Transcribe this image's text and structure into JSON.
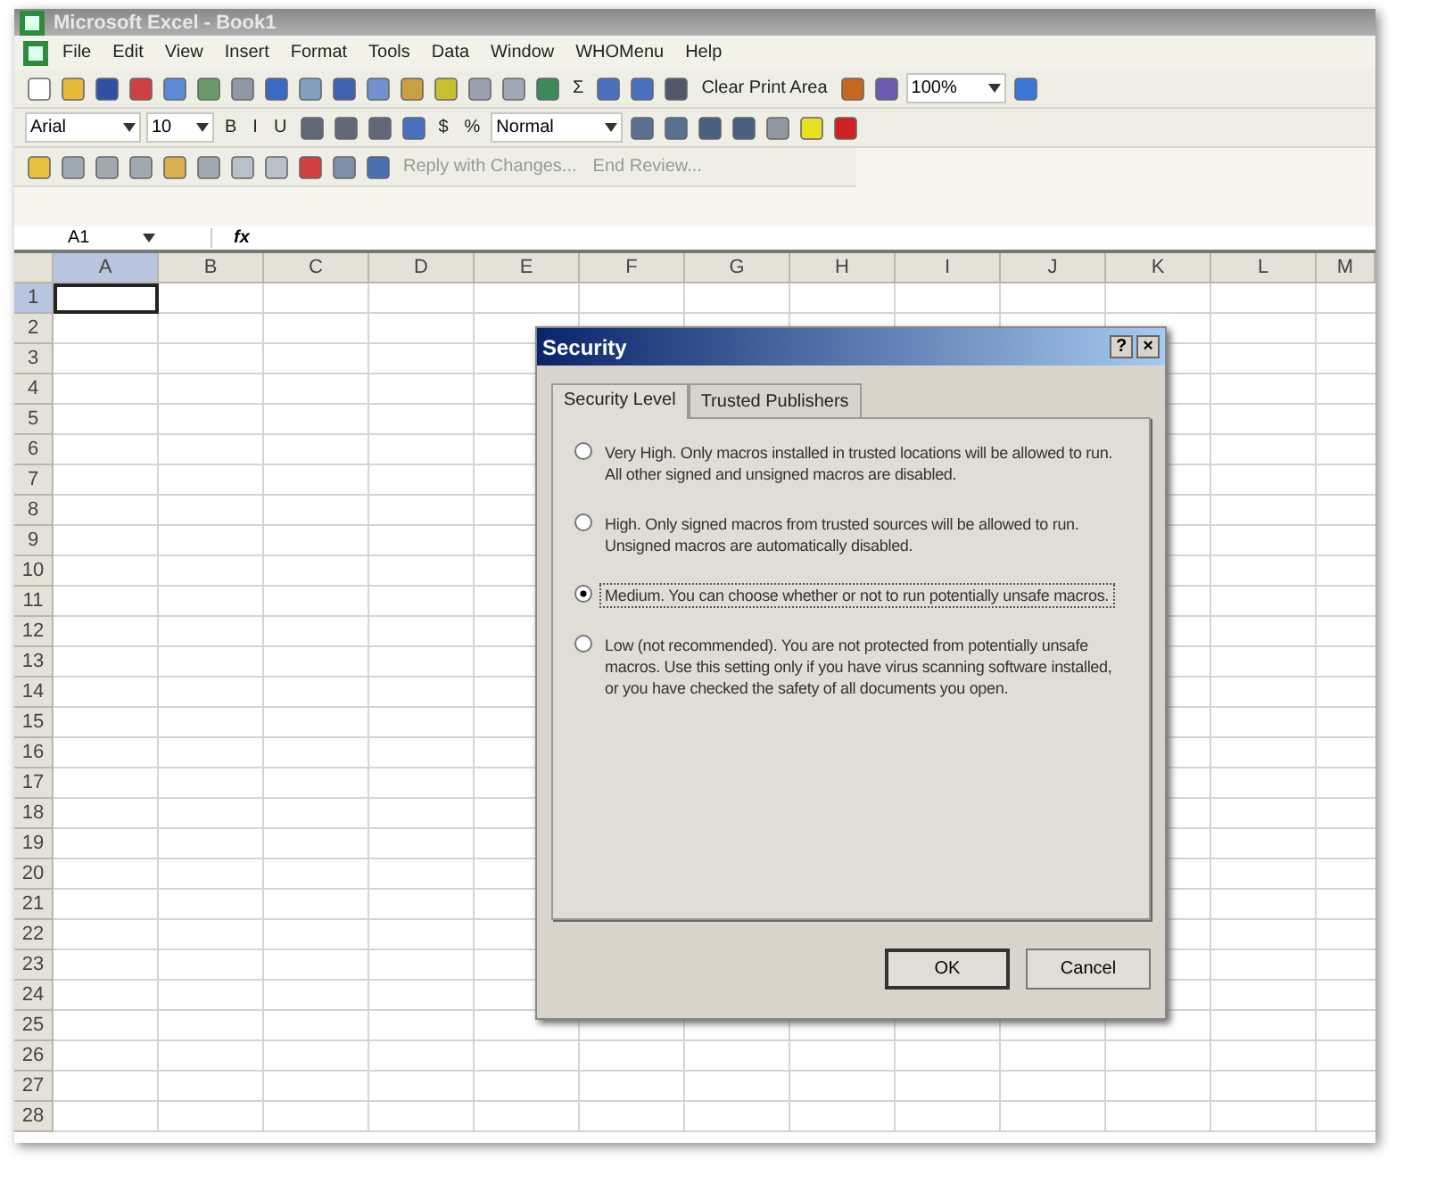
{
  "window": {
    "title": "Microsoft Excel - Book1"
  },
  "menu": [
    {
      "label": "File"
    },
    {
      "label": "Edit"
    },
    {
      "label": "View"
    },
    {
      "label": "Insert"
    },
    {
      "label": "Format"
    },
    {
      "label": "Tools"
    },
    {
      "label": "Data"
    },
    {
      "label": "Window"
    },
    {
      "label": "WHOMenu"
    },
    {
      "label": "Help"
    }
  ],
  "standard_toolbar": [
    {
      "kind": "icon",
      "color": "#ffffff"
    },
    {
      "kind": "icon",
      "color": "#e8b838"
    },
    {
      "kind": "icon",
      "color": "#3050a8"
    },
    {
      "kind": "icon",
      "color": "#d04040"
    },
    {
      "kind": "icon",
      "color": "#5a8ad8"
    },
    {
      "kind": "icon",
      "color": "#6a9a6a"
    },
    {
      "kind": "icon",
      "color": "#9098a8"
    },
    {
      "kind": "icon",
      "color": "#3a6ac8"
    },
    {
      "kind": "icon",
      "color": "#80a0c0"
    },
    {
      "kind": "icon",
      "color": "#4060b0"
    },
    {
      "kind": "icon",
      "color": "#7090d0"
    },
    {
      "kind": "icon",
      "color": "#c8a040"
    },
    {
      "kind": "icon",
      "color": "#c8c030"
    },
    {
      "kind": "icon",
      "color": "#9aa0b0"
    },
    {
      "kind": "icon",
      "color": "#a0a8b8"
    },
    {
      "kind": "icon",
      "color": "#3a8a5a"
    },
    {
      "kind": "text",
      "label": "Σ"
    },
    {
      "kind": "icon",
      "color": "#4a70c0"
    },
    {
      "kind": "icon",
      "color": "#4a70c0"
    },
    {
      "kind": "icon",
      "color": "#505868"
    },
    {
      "kind": "text",
      "label": "Clear Print Area"
    },
    {
      "kind": "icon",
      "color": "#c86820"
    },
    {
      "kind": "icon",
      "color": "#6a5ab0"
    },
    {
      "kind": "combo",
      "value": "100%"
    },
    {
      "kind": "icon",
      "color": "#3a78d8"
    }
  ],
  "formatting_toolbar": [
    {
      "kind": "combo",
      "value": "Arial"
    },
    {
      "kind": "combo",
      "value": "10"
    },
    {
      "kind": "text",
      "label": "B"
    },
    {
      "kind": "text",
      "label": "I"
    },
    {
      "kind": "text",
      "label": "U"
    },
    {
      "kind": "icon",
      "color": "#606878"
    },
    {
      "kind": "icon",
      "color": "#606878"
    },
    {
      "kind": "icon",
      "color": "#606878"
    },
    {
      "kind": "icon",
      "color": "#4a70c0"
    },
    {
      "kind": "text",
      "label": "$"
    },
    {
      "kind": "text",
      "label": "%"
    },
    {
      "kind": "combo",
      "value": "Normal"
    },
    {
      "kind": "icon",
      "color": "#5a7090"
    },
    {
      "kind": "icon",
      "color": "#5a7090"
    },
    {
      "kind": "icon",
      "color": "#4a6080"
    },
    {
      "kind": "icon",
      "color": "#4a6080"
    },
    {
      "kind": "icon",
      "color": "#9098a0"
    },
    {
      "kind": "icon",
      "color": "#e8e020"
    },
    {
      "kind": "icon",
      "color": "#d02020"
    }
  ],
  "reviewing_toolbar": [
    {
      "kind": "icon",
      "color": "#e8c040"
    },
    {
      "kind": "icon",
      "color": "#a0a8b0"
    },
    {
      "kind": "icon",
      "color": "#a0a8b0"
    },
    {
      "kind": "icon",
      "color": "#a0a8b0"
    },
    {
      "kind": "icon",
      "color": "#d8b050"
    },
    {
      "kind": "icon",
      "color": "#a0a8b0"
    },
    {
      "kind": "icon",
      "color": "#b8c0c8"
    },
    {
      "kind": "icon",
      "color": "#b8c0c8"
    },
    {
      "kind": "icon",
      "color": "#d04040"
    },
    {
      "kind": "icon",
      "color": "#8090a8"
    },
    {
      "kind": "icon",
      "color": "#4a70b0"
    },
    {
      "kind": "text",
      "label": "Reply with Changes...",
      "disabled": true
    },
    {
      "kind": "text",
      "label": "End Review...",
      "disabled": true
    }
  ],
  "formula_bar": {
    "name_box": "A1",
    "fx": "fx"
  },
  "sheet": {
    "columns": [
      {
        "label": "A",
        "selected": true
      },
      {
        "label": "B",
        "selected": false
      },
      {
        "label": "C",
        "selected": false
      },
      {
        "label": "D",
        "selected": false
      },
      {
        "label": "E",
        "selected": false
      },
      {
        "label": "F",
        "selected": false
      },
      {
        "label": "G",
        "selected": false
      },
      {
        "label": "H",
        "selected": false
      },
      {
        "label": "I",
        "selected": false
      },
      {
        "label": "J",
        "selected": false
      },
      {
        "label": "K",
        "selected": false
      },
      {
        "label": "L",
        "selected": false
      },
      {
        "label": "M",
        "selected": false
      }
    ],
    "rows": [
      {
        "label": "1",
        "selected": true
      },
      {
        "label": "2",
        "selected": false
      },
      {
        "label": "3",
        "selected": false
      },
      {
        "label": "4",
        "selected": false
      },
      {
        "label": "5",
        "selected": false
      },
      {
        "label": "6",
        "selected": false
      },
      {
        "label": "7",
        "selected": false
      },
      {
        "label": "8",
        "selected": false
      },
      {
        "label": "9",
        "selected": false
      },
      {
        "label": "10",
        "selected": false
      },
      {
        "label": "11",
        "selected": false
      },
      {
        "label": "12",
        "selected": false
      },
      {
        "label": "13",
        "selected": false
      },
      {
        "label": "14",
        "selected": false
      },
      {
        "label": "15",
        "selected": false
      },
      {
        "label": "16",
        "selected": false
      },
      {
        "label": "17",
        "selected": false
      },
      {
        "label": "18",
        "selected": false
      },
      {
        "label": "19",
        "selected": false
      },
      {
        "label": "20",
        "selected": false
      },
      {
        "label": "21",
        "selected": false
      },
      {
        "label": "22",
        "selected": false
      },
      {
        "label": "23",
        "selected": false
      },
      {
        "label": "24",
        "selected": false
      },
      {
        "label": "25",
        "selected": false
      },
      {
        "label": "26",
        "selected": false
      },
      {
        "label": "27",
        "selected": false
      },
      {
        "label": "28",
        "selected": false
      }
    ]
  },
  "dialog": {
    "title": "Security",
    "help": "?",
    "close": "×",
    "tabs": [
      {
        "label": "Security Level",
        "selected": true
      },
      {
        "label": "Trusted Publishers",
        "selected": false
      }
    ],
    "options": [
      {
        "text": "Very High. Only macros installed in trusted locations will be allowed to run. All other signed and unsigned macros are disabled.",
        "selected": false,
        "focused": false
      },
      {
        "text": "High. Only signed macros from trusted sources will be allowed to run. Unsigned macros are automatically disabled.",
        "selected": false,
        "focused": false
      },
      {
        "text": "Medium. You can choose whether or not to run potentially unsafe macros.",
        "selected": true,
        "focused": true
      },
      {
        "text": "Low (not recommended). You are not protected from potentially unsafe macros. Use this setting only if you have virus scanning software installed, or you have checked the safety of all documents you open.",
        "selected": false,
        "focused": false
      }
    ],
    "buttons": [
      {
        "label": "OK",
        "default": true
      },
      {
        "label": "Cancel",
        "default": false
      }
    ]
  }
}
